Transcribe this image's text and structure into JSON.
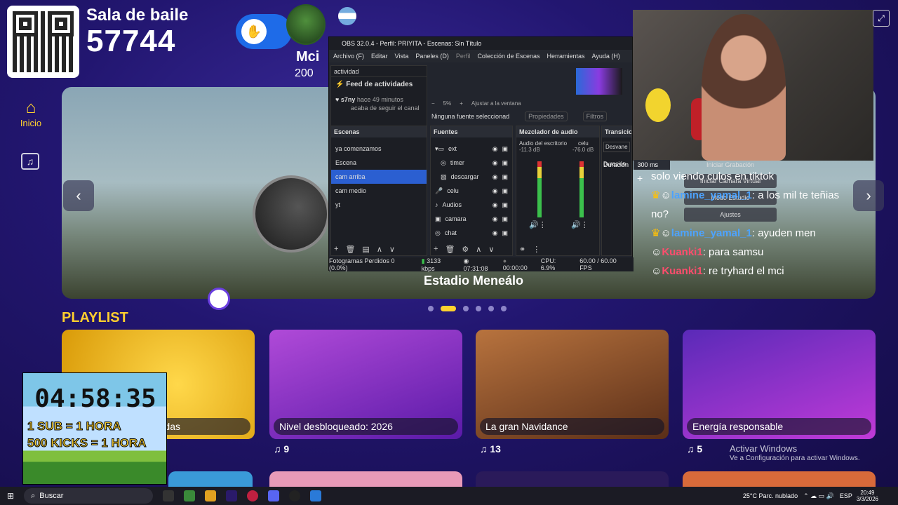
{
  "room": {
    "title": "Sala de baile",
    "code": "57744"
  },
  "player": {
    "name": "Mci",
    "score": "200"
  },
  "nav": {
    "home": "Inicio"
  },
  "banner": {
    "title": "Estadio Meneálo"
  },
  "playlist": {
    "heading": "PLAYLIST",
    "cards": [
      {
        "label": "adas",
        "count": ""
      },
      {
        "label": "Nivel desbloqueado: 2026",
        "count": "9"
      },
      {
        "label": "La gran Navidance",
        "count": "13"
      },
      {
        "label": "Energía responsable",
        "count": "5"
      }
    ]
  },
  "timer": {
    "time": "04:58:35",
    "line1": "1 SUB = 1 HORA",
    "line2": "500 KICKS = 1 HORA"
  },
  "obs": {
    "title": "OBS 32.0.4 - Perfil: PRIYITA - Escenas: Sin Título",
    "menu": [
      "Archivo (F)",
      "Editar",
      "Vista",
      "Paneles (D)",
      "Perfil",
      "Colección de Escenas",
      "Herramientas",
      "Ayuda (H)"
    ],
    "activity": {
      "dock": "actividad",
      "feed": "Feed de actividades",
      "user": "s7ny",
      "time": "hace 49 minutos",
      "action": "acaba de seguir el canal"
    },
    "zoom": "5%",
    "fit": "Ajustar a la ventana",
    "no_source": "Ninguna fuente seleccionad",
    "properties": "Propiedades",
    "filters": "Filtros",
    "scenes_title": "Escenas",
    "scenes": [
      "ya comenzamos",
      "Escena",
      "cam arriba",
      "cam medio",
      "yt"
    ],
    "selected_scene": "cam arriba",
    "sources_title": "Fuentes",
    "sources": [
      "ext",
      "timer",
      "descargar",
      "celu",
      "Audios",
      "camara",
      "chat"
    ],
    "mixer_title": "Mezclador de audio",
    "mixer": [
      {
        "name": "Audio del escritorio",
        "db": "-11.3 dB"
      },
      {
        "name": "celu",
        "db": "-76.0 dB"
      }
    ],
    "transitions_title": "Transicio",
    "fade": "Desvane",
    "duration_label": "Duración",
    "duration": "300 ms",
    "status": {
      "dropped": "Fotogramas Perdidos 0 (0.0%)",
      "bitrate": "3133 kbps",
      "live": "07:31:08",
      "rec": "00:00:00",
      "cpu": "CPU: 6.9%",
      "fps": "60.00 / 60.00 FPS"
    }
  },
  "controls": {
    "record": "Iniciar Grabación",
    "virtual_cam": "Iniciar Cámara Virtual",
    "studio": "Modo Estudio",
    "settings": "Ajustes"
  },
  "chat": [
    {
      "user": "",
      "msg": "solo viendo culos en tiktok"
    },
    {
      "user": "lamine_yamal_1",
      "msg": ": a los mil te teñias"
    },
    {
      "user": "",
      "msg": "no?"
    },
    {
      "user": "lamine_yamal_1",
      "msg": ": ayuden men"
    },
    {
      "user": "Kuanki1",
      "msg": ": para samsu"
    },
    {
      "user": "Kuanki1",
      "msg": ": re tryhard el mci"
    }
  ],
  "windows": {
    "activate": "Activar Windows",
    "activate_sub": "Ve a Configuración para activar Windows.",
    "search": "Buscar",
    "weather": "25°C  Parc. nublado",
    "lang": "ESP",
    "time": "20:49",
    "date": "3/3/2026"
  }
}
